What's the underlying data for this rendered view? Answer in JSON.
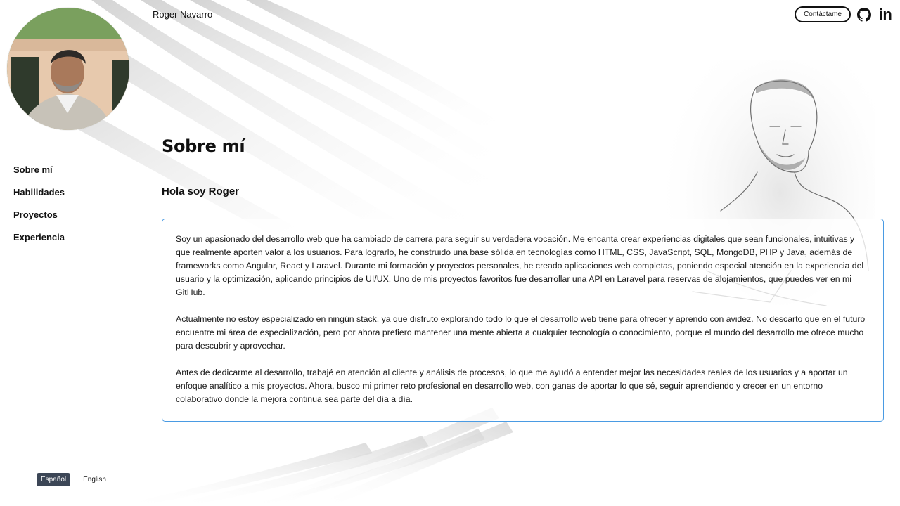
{
  "header": {
    "site_name": "Roger Navarro",
    "contact_label": "Contáctame",
    "github_icon": "github-icon",
    "linkedin_icon": "linkedin-icon",
    "linkedin_text": "in"
  },
  "profile": {
    "avatar_icon": "profile-photo"
  },
  "sidebar": {
    "items": [
      {
        "label": "Sobre mí"
      },
      {
        "label": "Habilidades"
      },
      {
        "label": "Proyectos"
      },
      {
        "label": "Experiencia"
      }
    ]
  },
  "main": {
    "title": "Sobre mí",
    "greeting": "Hola soy Roger",
    "paragraphs": [
      "Soy un apasionado del desarrollo web que ha cambiado de carrera para seguir su verdadera vocación. Me encanta crear experiencias digitales que sean funcionales, intuitivas y que realmente aporten valor a los usuarios. Para lograrlo, he construido una base sólida en tecnologías como HTML, CSS, JavaScript, SQL, MongoDB, PHP y Java, además de frameworks como Angular, React y Laravel. Durante mi formación y proyectos personales, he creado aplicaciones web completas, poniendo especial atención en la experiencia del usuario y la optimización, aplicando principios de UI/UX. Uno de mis proyectos favoritos fue desarrollar una API en Laravel para reservas de alojamientos, que puedes ver en mi GitHub.",
      "Actualmente no estoy especializado en ningún stack, ya que disfruto explorando todo lo que el desarrollo web tiene para ofrecer y aprendo con avidez. No descarto que en el futuro encuentre mi área de especialización, pero por ahora prefiero mantener una mente abierta a cualquier tecnología o conocimiento, porque el mundo del desarrollo me ofrece mucho para descubrir y aprovechar.",
      "Antes de dedicarme al desarrollo, trabajé en atención al cliente y análisis de procesos, lo que me ayudó a entender mejor las necesidades reales de los usuarios y a aportar un enfoque analítico a mis proyectos. Ahora, busco mi primer reto profesional en desarrollo web, con ganas de aportar lo que sé, seguir aprendiendo y crecer en un entorno colaborativo donde la mejora continua sea parte del día a día."
    ]
  },
  "language": {
    "options": [
      {
        "label": "Español",
        "active": true
      },
      {
        "label": "English",
        "active": false
      }
    ]
  },
  "colors": {
    "card_border": "#4a9be3",
    "active_lang_bg": "#3c4656",
    "text": "#111111"
  }
}
